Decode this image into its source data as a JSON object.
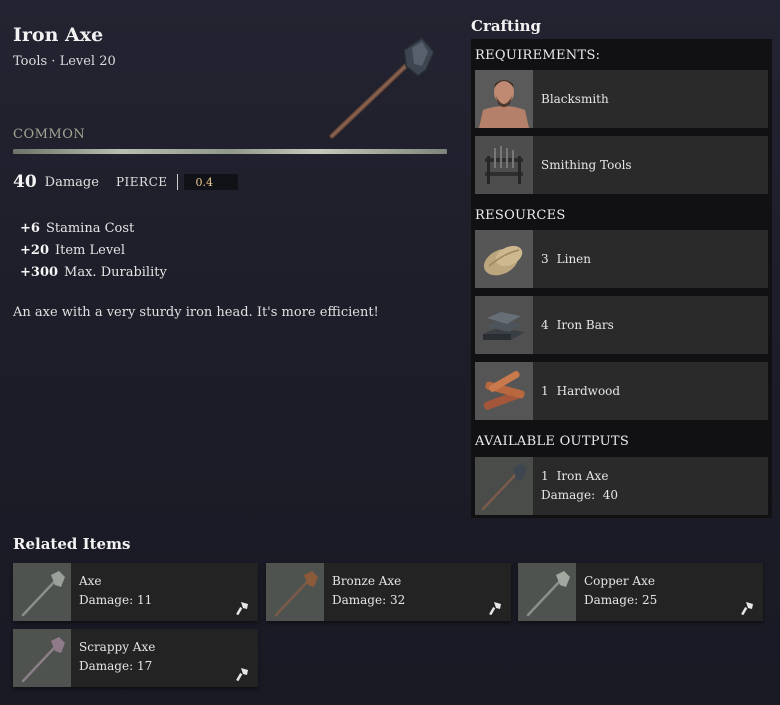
{
  "item": {
    "name": "Iron Axe",
    "category": "Tools",
    "level": "Level 20",
    "rarity": "COMMON",
    "damage_value": "40",
    "damage_label": "Damage",
    "damage_type": "PIERCE",
    "damage_type_value": "0.4",
    "stats": [
      {
        "value": "+6",
        "label": "Stamina Cost"
      },
      {
        "value": "+20",
        "label": "Item Level"
      },
      {
        "value": "+300",
        "label": "Max. Durability"
      }
    ],
    "description": "An axe with a very sturdy iron head. It's more efficient!"
  },
  "crafting": {
    "title": "Crafting",
    "requirements_label": "REQUIREMENTS:",
    "requirements": [
      {
        "name": "Blacksmith",
        "icon": "blacksmith-portrait-icon"
      },
      {
        "name": "Smithing Tools",
        "icon": "smithing-tools-icon"
      }
    ],
    "resources_label": "RESOURCES",
    "resources": [
      {
        "qty": "3",
        "name": "Linen",
        "icon": "linen-icon"
      },
      {
        "qty": "4",
        "name": "Iron Bars",
        "icon": "iron-bars-icon"
      },
      {
        "qty": "1",
        "name": "Hardwood",
        "icon": "hardwood-icon"
      }
    ],
    "outputs_label": "AVAILABLE OUTPUTS",
    "outputs": [
      {
        "qty": "1",
        "name": "Iron Axe",
        "damage_label": "Damage:",
        "damage": "40",
        "icon": "iron-axe-icon"
      }
    ]
  },
  "related": {
    "title": "Related Items",
    "items": [
      {
        "name": "Axe",
        "damage_label": "Damage:",
        "damage": "11",
        "icon": "axe-icon"
      },
      {
        "name": "Bronze Axe",
        "damage_label": "Damage:",
        "damage": "32",
        "icon": "bronze-axe-icon"
      },
      {
        "name": "Copper Axe",
        "damage_label": "Damage:",
        "damage": "25",
        "icon": "copper-axe-icon"
      },
      {
        "name": "Scrappy Axe",
        "damage_label": "Damage:",
        "damage": "17",
        "icon": "scrappy-axe-icon"
      }
    ]
  },
  "colors": {
    "background": "#21212e",
    "panel": "#111114",
    "row": "#2a2a2a",
    "rarity_text": "#9fa592",
    "pierce_value": "#e9c98e"
  }
}
